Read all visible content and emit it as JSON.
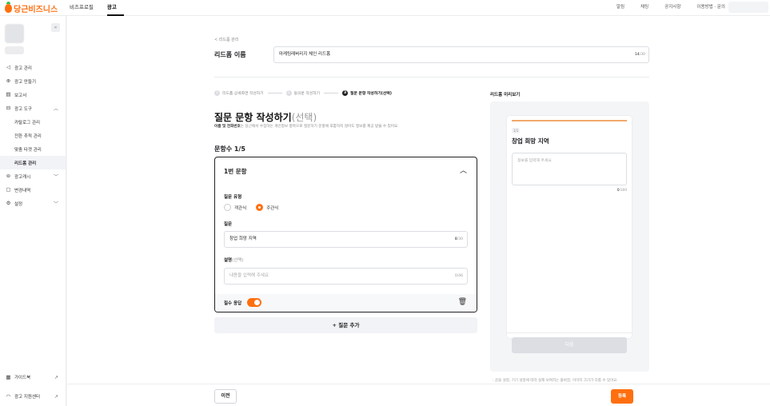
{
  "brand": {
    "name": "당근비즈니스",
    "color": "#ff6f0f"
  },
  "topnav": {
    "items": [
      {
        "label": "비즈프로필",
        "active": false
      },
      {
        "label": "광고",
        "active": true
      }
    ],
    "right": [
      "알림",
      "채팅",
      "공지사항",
      "이용방법 · 문의"
    ]
  },
  "sidebar": {
    "collapse_icon": "«",
    "menu": [
      {
        "label": "광고 관리",
        "icon": "megaphone-icon",
        "glyph": "◁"
      },
      {
        "label": "광고 만들기",
        "icon": "plus-circle-icon",
        "glyph": "⊕"
      },
      {
        "label": "보고서",
        "icon": "report-icon",
        "glyph": "▤"
      },
      {
        "label": "광고 도구",
        "icon": "toolbox-icon",
        "glyph": "⊟",
        "chevron": "︿"
      },
      {
        "label": "카탈로그 관리",
        "sub": true
      },
      {
        "label": "전환 추적 관리",
        "sub": true
      },
      {
        "label": "맞춤 타겟 관리",
        "sub": true
      },
      {
        "label": "리드폼 관리",
        "sub": true,
        "active": true
      },
      {
        "label": "광고캐시",
        "icon": "coin-icon",
        "glyph": "⊜",
        "chevron": "﹀"
      },
      {
        "label": "변경내역",
        "icon": "history-icon",
        "glyph": "▢"
      },
      {
        "label": "설정",
        "icon": "gear-icon",
        "glyph": "⚙",
        "chevron": "﹀"
      }
    ],
    "bottom": [
      {
        "label": "가이드북",
        "icon": "book-icon",
        "glyph": "▦",
        "arrow": "↗"
      },
      {
        "label": "광고 지원센터",
        "icon": "headset-icon",
        "glyph": "◠",
        "arrow": "↗"
      }
    ]
  },
  "form": {
    "back_label": "< 리드폼 관리",
    "name_label": "리드폼 이름",
    "name_value": "마케팅레버리지 체인 리드폼",
    "name_count": "14",
    "name_max": "/30"
  },
  "steps": [
    {
      "num": "1",
      "label": "리드폼 상세화면 작성하기",
      "active": false
    },
    {
      "num": "2",
      "label": "동의문 작성하기",
      "active": false
    },
    {
      "num": "3",
      "label": "질문 문항 작성하기(선택)",
      "active": true
    }
  ],
  "section": {
    "title": "질문 문항 작성하기",
    "title_optional": "(선택)",
    "desc_bold": "이름 및 전화번호",
    "desc_rest": "는 당근에서 수집하는 개인정보 항목으로 질문하기 문항에 포함하지 않아도 정보를 제공 받을 수 있어요.",
    "count_label": "문항수 1/5"
  },
  "question": {
    "header": "1번 문항",
    "type_label": "질문 유형",
    "types": [
      {
        "label": "객관식",
        "selected": false
      },
      {
        "label": "주관식",
        "selected": true
      }
    ],
    "question_label": "질문",
    "question_value": "창업 희망 지역",
    "question_count": "8",
    "question_max": "/30",
    "desc_label": "설명",
    "desc_optional": "(선택)",
    "desc_placeholder": "내용을 입력해 주세요",
    "desc_count": "0/46",
    "required_label": "필수 응답",
    "required_on": true
  },
  "add_label": "+ 질문 추가",
  "preview": {
    "title": "리드폼 미리보기",
    "tag": "1/1",
    "question": "창업 희망 지역",
    "placeholder": "정보를 입력해 주세요",
    "count": "0",
    "count_max": "/300",
    "next_label": "다음",
    "note": "· 글꼴 설정, 기기 설정에 따라 실제 보여지는 줄바꿈, 이미지 크기가 다를 수 있어요."
  },
  "footer": {
    "prev_label": "이전",
    "submit_label": "등록"
  }
}
